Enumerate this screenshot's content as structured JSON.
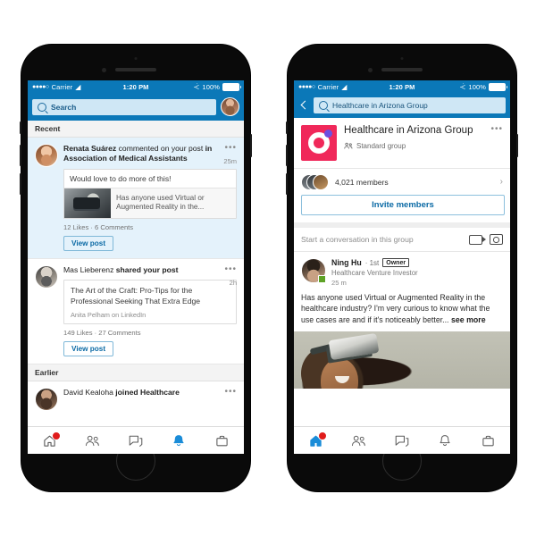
{
  "meta": {
    "accent_blue": "#0b78b8",
    "link_blue": "#0b6aa5",
    "unread_bg": "#e4f2fb",
    "badge_red": "#e01b1b",
    "group_logo_pink": "#f0285a",
    "group_logo_purple": "#6b4fe0"
  },
  "status_bar": {
    "signal_dots": "●●●●○",
    "carrier": "Carrier",
    "wifi_icon": "wifi-icon",
    "time": "1:20 PM",
    "battery_percent": "100%",
    "bluetooth_icon": "bluetooth-icon"
  },
  "left_phone": {
    "search": {
      "placeholder": "Search",
      "icon": "search-icon",
      "avatar": "profile-avatar"
    },
    "sections": [
      {
        "header": "Recent",
        "items": [
          {
            "avatar": "av-renata",
            "actor": "Renata Suárez",
            "action": "commented on your post",
            "context": "in Association of Medical Assistants",
            "time": "25m",
            "unread": true,
            "quote": "Would love to do more of this!",
            "snippet": "Has anyone used Virtual or Augmented Reality in the...",
            "meta": "12 Likes  ·  6 Comments",
            "cta": "View post",
            "menu": "•••"
          },
          {
            "avatar": "av-mas",
            "actor": "Mas Lieberenz",
            "action": "shared your post",
            "context": "",
            "time": "2h",
            "unread": false,
            "article_title": "The Art of the Craft: Pro-Tips for the Professional Seeking That Extra Edge",
            "article_source": "Anita Pelham on LinkedIn",
            "meta": "149 Likes  ·  27 Comments",
            "cta": "View post",
            "menu": "•••"
          }
        ]
      },
      {
        "header": "Earlier",
        "items": [
          {
            "avatar": "av-david",
            "actor": "David Kealoha",
            "action": "joined Healthcare",
            "context": "",
            "time": "",
            "unread": false,
            "menu": "•••"
          }
        ]
      }
    ],
    "tabs": [
      {
        "name": "home",
        "icon": "home-icon",
        "active": false,
        "badge": true
      },
      {
        "name": "my-network",
        "icon": "people-icon",
        "active": false,
        "badge": false
      },
      {
        "name": "messaging",
        "icon": "messaging-icon",
        "active": false,
        "badge": false
      },
      {
        "name": "notifications",
        "icon": "bell-icon",
        "active": true,
        "badge": false
      },
      {
        "name": "jobs",
        "icon": "briefcase-icon",
        "active": false,
        "badge": false
      }
    ]
  },
  "right_phone": {
    "nav": {
      "back_icon": "chevron-left-icon",
      "search_icon": "search-icon",
      "search_value": "Healthcare in Arizona Group"
    },
    "group": {
      "logo": "group-logo",
      "name": "Healthcare in Arizona Group",
      "type_icon": "group-type-icon",
      "type": "Standard group",
      "menu": "•••",
      "members_count": "4,021 members",
      "members_chevron": "›",
      "invite_label": "Invite members"
    },
    "composer": {
      "placeholder": "Start a conversation in this group",
      "video_icon": "video-icon",
      "camera_icon": "camera-icon"
    },
    "post": {
      "author": "Ning Hu",
      "degree": "· 1st",
      "badge_label": "Owner",
      "headline": "Healthcare Venture Investor",
      "time": "25 m",
      "text": "Has anyone used Virtual or Augmented Reality in the healthcare industry? I'm very curious to know what the use cases are and if it's noticeably better...",
      "see_more": "see more",
      "image": "vr-headset-photo"
    },
    "tabs": [
      {
        "name": "home",
        "icon": "home-icon",
        "active": true,
        "badge": true
      },
      {
        "name": "my-network",
        "icon": "people-icon",
        "active": false,
        "badge": false
      },
      {
        "name": "messaging",
        "icon": "messaging-icon",
        "active": false,
        "badge": false
      },
      {
        "name": "notifications",
        "icon": "bell-icon",
        "active": false,
        "badge": false
      },
      {
        "name": "jobs",
        "icon": "briefcase-icon",
        "active": false,
        "badge": false
      }
    ]
  }
}
